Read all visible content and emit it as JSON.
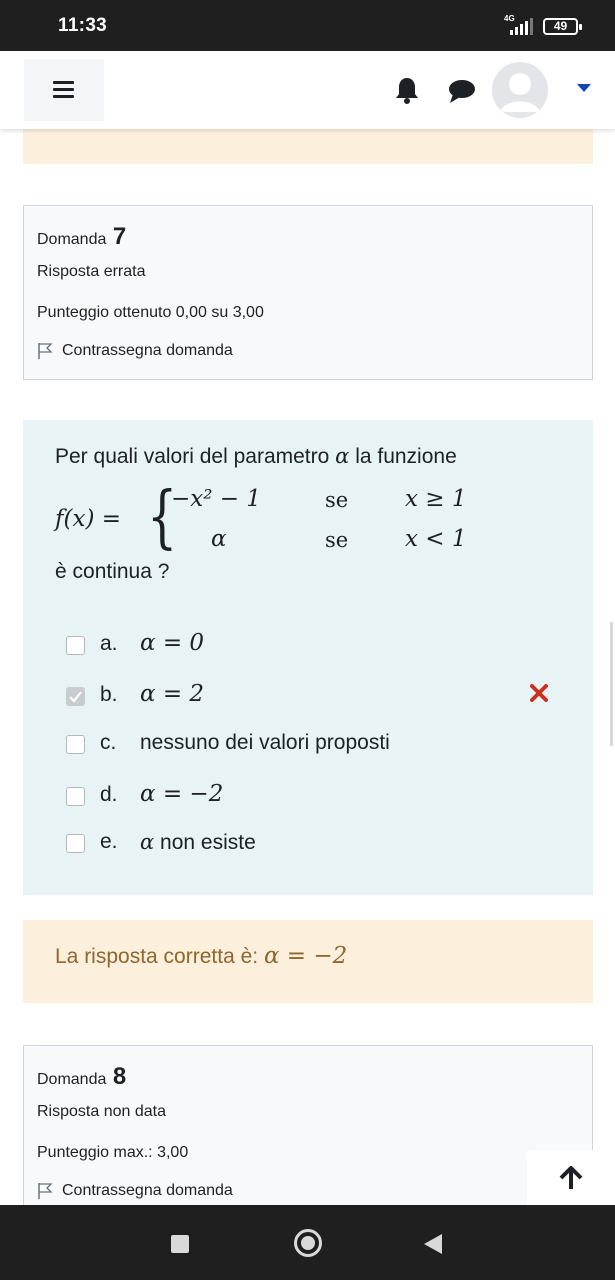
{
  "status_bar": {
    "time": "11:33",
    "network": "4G",
    "battery": "49"
  },
  "navbar": {
    "menu_icon": "hamburger-menu-icon",
    "notifications_icon": "bell-icon",
    "messages_icon": "chat-bubble-icon",
    "user_icon": "user-avatar-icon",
    "dropdown_icon": "caret-down-icon"
  },
  "question7": {
    "label": "Domanda",
    "number": "7",
    "state": "Risposta errata",
    "grade": "Punteggio ottenuto 0,00 su 3,00",
    "flag_label": "Contrassegna domanda",
    "text_before": "Per quali valori del parametro",
    "alpha": "α",
    "text_after": "la funzione",
    "function_lhs": "f(x) =",
    "case1_value": "−x² − 1",
    "case1_se": "se",
    "case1_condition": "x ≥ 1",
    "case2_value": "α",
    "case2_se": "se",
    "case2_condition": "x < 1",
    "text_end": "è continua  ?",
    "options": [
      {
        "letter": "a.",
        "label": "α = 0",
        "checked": false
      },
      {
        "letter": "b.",
        "label": "α = 2",
        "checked": true
      },
      {
        "letter": "c.",
        "label": "nessuno dei valori proposti",
        "checked": false
      },
      {
        "letter": "d.",
        "label": "α = −2",
        "checked": false
      },
      {
        "letter": "e.",
        "label": "α non esiste",
        "checked": false
      }
    ],
    "incorrect_icon": "red-x-icon",
    "right_answer_prefix": "La risposta corretta è:",
    "right_answer_value": "α = −2"
  },
  "question8": {
    "label": "Domanda",
    "number": "8",
    "state": "Risposta non data",
    "grade": "Punteggio max.: 3,00",
    "flag_label": "Contrassegna domanda"
  },
  "scroll_top_icon": "arrow-up-icon",
  "colors": {
    "feedback_bg": "#fcefdc",
    "formulation_bg": "#e7f3f5",
    "info_bg": "#f8f9fa",
    "right_answer_text": "#8e662e",
    "incorrect": "#ca3120",
    "brand_blue": "#0f47ad"
  }
}
